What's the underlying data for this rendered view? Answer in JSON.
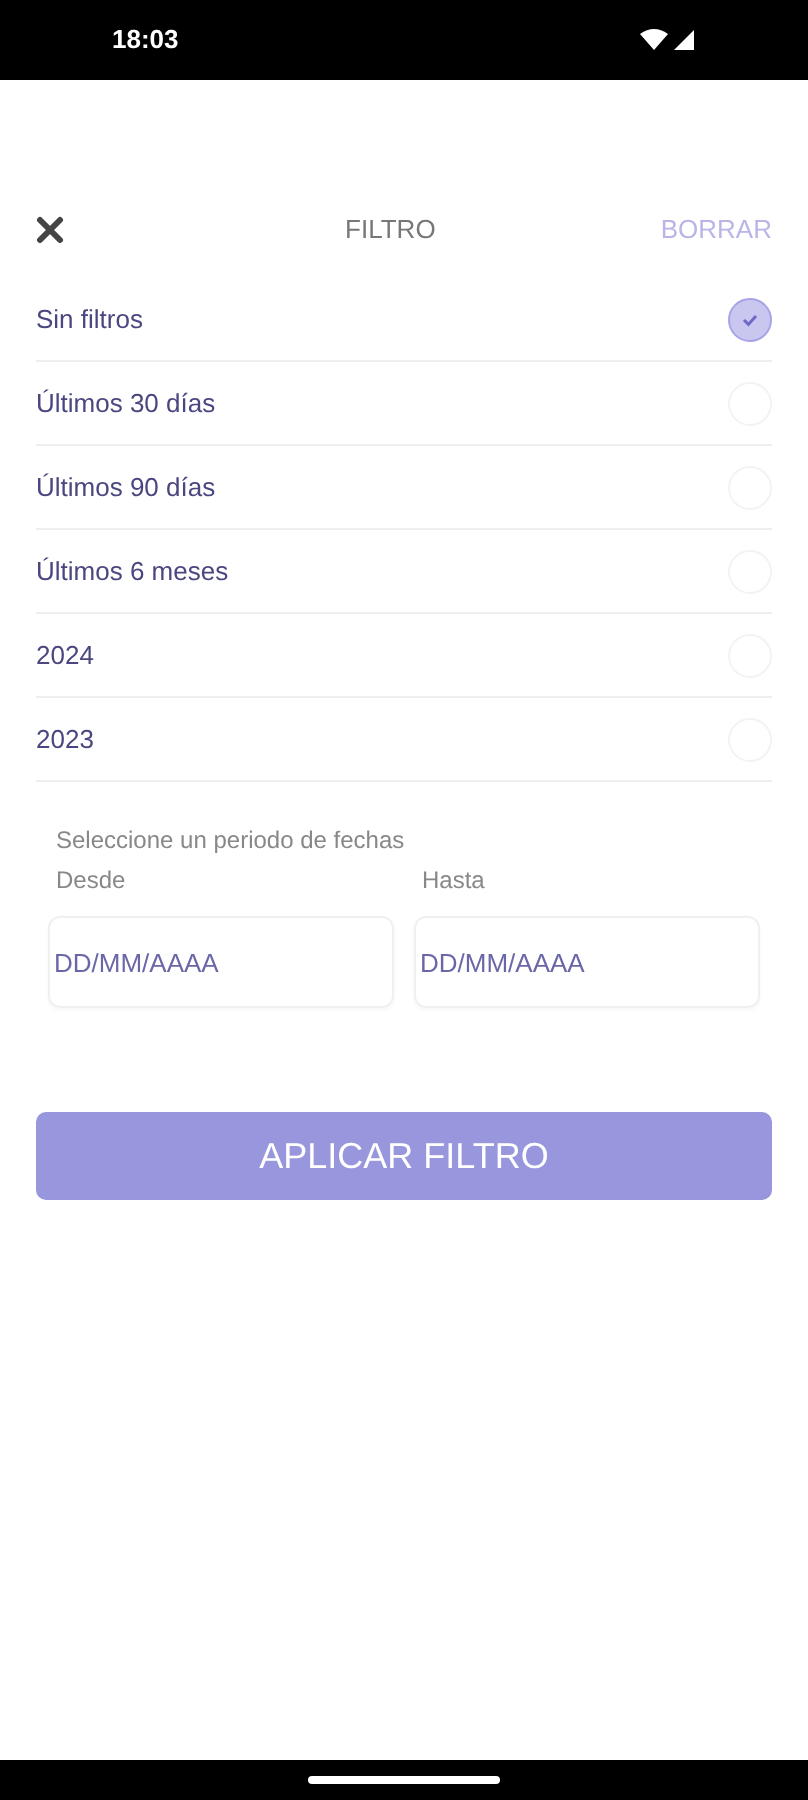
{
  "status_bar": {
    "time": "18:03"
  },
  "header": {
    "title": "FILTRO",
    "clear": "BORRAR"
  },
  "options": [
    {
      "label": "Sin filtros",
      "selected": true
    },
    {
      "label": "Últimos 30 días",
      "selected": false
    },
    {
      "label": "Últimos 90 días",
      "selected": false
    },
    {
      "label": "Últimos 6 meses",
      "selected": false
    },
    {
      "label": "2024",
      "selected": false
    },
    {
      "label": "2023",
      "selected": false
    }
  ],
  "date_range": {
    "caption": "Seleccione un periodo de fechas",
    "fields": [
      {
        "label": "Desde",
        "placeholder": "DD/MM/AAAA"
      },
      {
        "label": "Hasta",
        "placeholder": "DD/MM/AAAA"
      }
    ]
  },
  "apply_button": "APLICAR FILTRO"
}
